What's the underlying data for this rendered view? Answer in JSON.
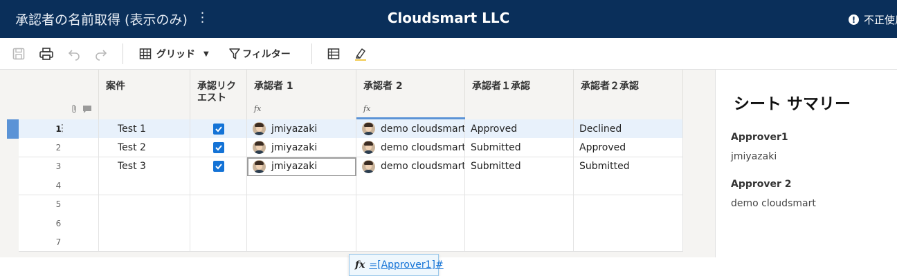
{
  "header": {
    "sheet_title": "承認者の名前取得 (表示のみ)",
    "title_menu": "⋮",
    "org_name": "Cloudsmart LLC",
    "alert_icon": "!",
    "alert_text": "不正使用"
  },
  "toolbar": {
    "save_icon": "save-icon",
    "print_icon": "print-icon",
    "undo_icon": "undo-icon",
    "redo_icon": "redo-icon",
    "grid_label": "グリッド",
    "grid_caret": "▼",
    "filter_label": "フィルター",
    "form_icon": "form-icon",
    "highlight_icon": "highlight-icon"
  },
  "grid": {
    "header_icons": [
      "attachment-icon",
      "comment-icon"
    ],
    "columns": [
      {
        "label": "案件",
        "fx": ""
      },
      {
        "label": "承認リク\nエスト",
        "fx": ""
      },
      {
        "label": "承認者 1",
        "fx": "fx"
      },
      {
        "label": "承認者 2",
        "fx": "fx"
      },
      {
        "label": "承認者１承認",
        "fx": ""
      },
      {
        "label": "承認者２承認",
        "fx": ""
      }
    ],
    "rows": [
      {
        "num": "1",
        "case": "Test 1",
        "checked": true,
        "approver1": "jmiyazaki",
        "approver2": "demo cloudsmart",
        "a1_status": "Approved",
        "a2_status": "Declined"
      },
      {
        "num": "2",
        "case": "Test 2",
        "checked": true,
        "approver1": "jmiyazaki",
        "approver2": "demo cloudsmart",
        "a1_status": "Submitted",
        "a2_status": "Approved"
      },
      {
        "num": "3",
        "case": "Test 3",
        "checked": true,
        "approver1": "jmiyazaki",
        "approver2": "demo cloudsmart",
        "a1_status": "Submitted",
        "a2_status": "Submitted"
      },
      {
        "num": "4",
        "case": "",
        "checked": false,
        "approver1": "",
        "approver2": "",
        "a1_status": "",
        "a2_status": ""
      },
      {
        "num": "5",
        "case": "",
        "checked": false,
        "approver1": "",
        "approver2": "",
        "a1_status": "",
        "a2_status": ""
      },
      {
        "num": "6",
        "case": "",
        "checked": false,
        "approver1": "",
        "approver2": "",
        "a1_status": "",
        "a2_status": ""
      },
      {
        "num": "7",
        "case": "",
        "checked": false,
        "approver1": "",
        "approver2": "",
        "a1_status": "",
        "a2_status": ""
      }
    ],
    "row_menu": "⋮",
    "formula_glyph": "fx",
    "formula": "=[Approver1]#"
  },
  "summary": {
    "title": "シート サマリー",
    "fields": [
      {
        "label": "Approver1",
        "value": "jmiyazaki"
      },
      {
        "label": "Approver 2",
        "value": "demo cloudsmart"
      }
    ]
  },
  "colors": {
    "header_bg": "#0a2f5a",
    "accent": "#1473d6",
    "selected_row": "#e8f1fb",
    "row_marker": "#5b93d6"
  }
}
